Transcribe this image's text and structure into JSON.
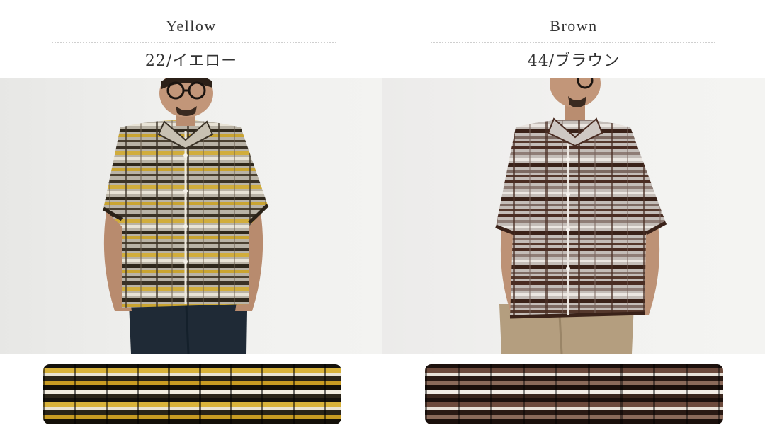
{
  "variants": [
    {
      "name_en": "Yellow",
      "name_jp": "22/イエロー"
    },
    {
      "name_en": "Brown",
      "name_jp": "44/ブラウン"
    }
  ],
  "images": {
    "yellow_photo": "model-wearing-yellow-check-knit-shirt",
    "yellow_swatch": "yellow-knit-fabric-closeup",
    "brown_photo": "model-wearing-brown-check-knit-shirt",
    "brown_swatch": "brown-knit-fabric-closeup"
  },
  "colors": {
    "background": "#ffffff",
    "text": "#333333",
    "divider": "#cfcfcf",
    "yellow_accent": "#d8b23a",
    "brown_accent": "#4a2a20"
  }
}
